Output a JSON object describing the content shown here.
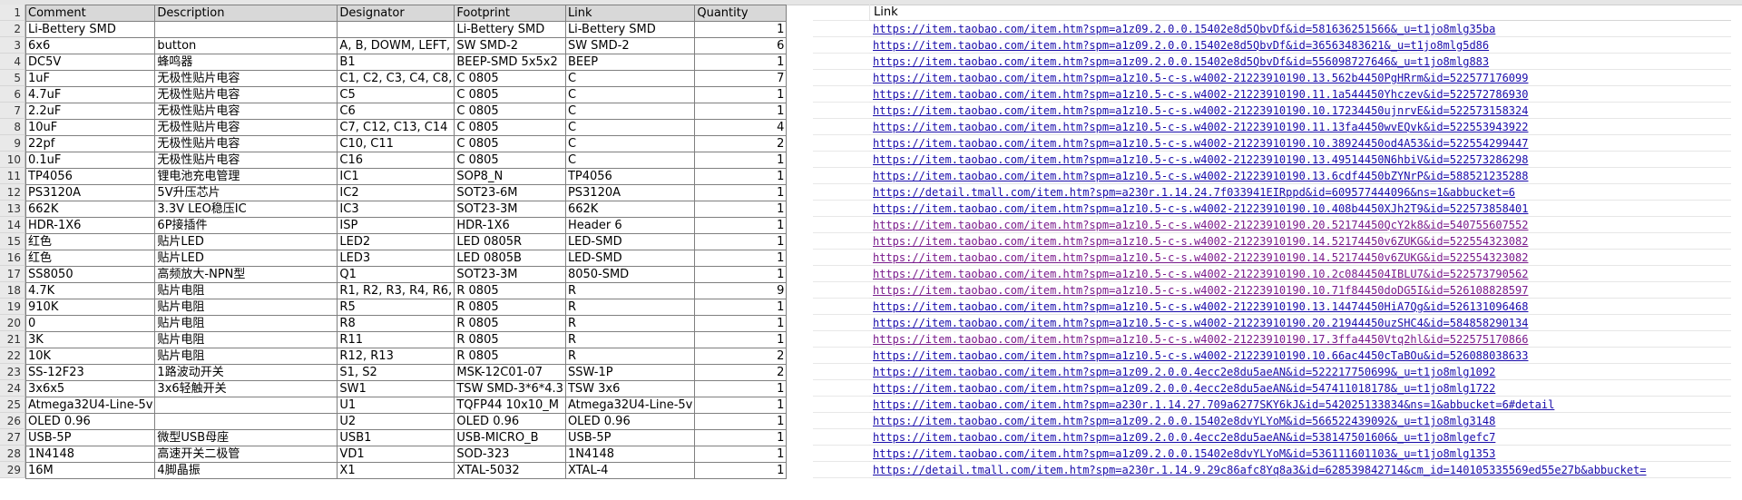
{
  "sheet": {
    "row_numbers": [
      "1",
      "2",
      "3",
      "4",
      "5",
      "6",
      "7",
      "8",
      "9",
      "10",
      "11",
      "12",
      "13",
      "14",
      "15",
      "16",
      "17",
      "18",
      "19",
      "20",
      "21",
      "22",
      "23",
      "24",
      "25",
      "26",
      "27",
      "28",
      "29"
    ],
    "headers": [
      "Comment",
      "Description",
      "Designator",
      "Footprint",
      "Link",
      "Quantity"
    ],
    "link_header": "Link",
    "rows": [
      [
        "Li-Bettery SMD",
        "",
        "",
        "Li-Bettery SMD",
        "Li-Bettery SMD",
        "1"
      ],
      [
        "6x6",
        "button",
        "A, B, DOWM, LEFT,",
        "SW SMD-2",
        "SW SMD-2",
        "6"
      ],
      [
        "DC5V",
        "蜂鸣器",
        "B1",
        "BEEP-SMD 5x5x2",
        "BEEP",
        "1"
      ],
      [
        "1uF",
        "无极性贴片电容",
        "C1, C2, C3, C4, C8,",
        "C 0805",
        "C",
        "7"
      ],
      [
        "4.7uF",
        "无极性贴片电容",
        "C5",
        "C 0805",
        "C",
        "1"
      ],
      [
        "2.2uF",
        "无极性贴片电容",
        "C6",
        "C 0805",
        "C",
        "1"
      ],
      [
        "10uF",
        "无极性贴片电容",
        "C7, C12, C13, C14",
        "C 0805",
        "C",
        "4"
      ],
      [
        "22pf",
        "无极性贴片电容",
        "C10, C11",
        "C 0805",
        "C",
        "2"
      ],
      [
        "0.1uF",
        "无极性贴片电容",
        "C16",
        "C 0805",
        "C",
        "1"
      ],
      [
        "TP4056",
        "锂电池充电管理",
        "IC1",
        "SOP8_N",
        "TP4056",
        "1"
      ],
      [
        "PS3120A",
        "5V升压芯片",
        "IC2",
        "SOT23-6M",
        "PS3120A",
        "1"
      ],
      [
        "662K",
        "3.3V LEO稳压IC",
        "IC3",
        "SOT23-3M",
        "662K",
        "1"
      ],
      [
        "HDR-1X6",
        "6P接插件",
        "ISP",
        "HDR-1X6",
        "Header 6",
        "1"
      ],
      [
        "红色",
        "贴片LED",
        "LED2",
        "LED 0805R",
        "LED-SMD",
        "1"
      ],
      [
        "红色",
        "贴片LED",
        "LED3",
        "LED 0805B",
        "LED-SMD",
        "1"
      ],
      [
        "SS8050",
        "高频放大-NPN型",
        "Q1",
        "SOT23-3M",
        "8050-SMD",
        "1"
      ],
      [
        "4.7K",
        "贴片电阻",
        "R1, R2, R3, R4, R6,",
        "R 0805",
        "R",
        "9"
      ],
      [
        "910K",
        "贴片电阻",
        "R5",
        "R 0805",
        "R",
        "1"
      ],
      [
        "0",
        "贴片电阻",
        "R8",
        "R 0805",
        "R",
        "1"
      ],
      [
        "3K",
        "贴片电阻",
        "R11",
        "R 0805",
        "R",
        "1"
      ],
      [
        "10K",
        "贴片电阻",
        "R12, R13",
        "R 0805",
        "R",
        "2"
      ],
      [
        "SS-12F23",
        "1路波动开关",
        "S1, S2",
        "MSK-12C01-07",
        "SSW-1P",
        "2"
      ],
      [
        "3x6x5",
        "3x6轻触开关",
        "SW1",
        "TSW SMD-3*6*4.3",
        "TSW 3x6",
        "1"
      ],
      [
        "Atmega32U4-Line-5v",
        "",
        "U1",
        "TQFP44 10x10_M",
        "Atmega32U4-Line-5v",
        "1"
      ],
      [
        "OLED 0.96",
        "",
        "U2",
        "OLED 0.96",
        "OLED 0.96",
        "1"
      ],
      [
        "USB-5P",
        "微型USB母座",
        "USB1",
        "USB-MICRO_B",
        "USB-5P",
        "1"
      ],
      [
        "1N4148",
        "高速开关二极管",
        "VD1",
        "SOD-323",
        "1N4148",
        "1"
      ],
      [
        "16M",
        "4脚晶振",
        "X1",
        "XTAL-5032",
        "XTAL-4",
        "1"
      ]
    ],
    "links": [
      {
        "url": "https://item.taobao.com/item.htm?spm=a1z09.2.0.0.15402e8d5QbvDf&id=581636251566&_u=t1jo8mlg35ba",
        "visited": false
      },
      {
        "url": "https://item.taobao.com/item.htm?spm=a1z09.2.0.0.15402e8d5QbvDf&id=36563483621&_u=t1jo8mlg5d86",
        "visited": false
      },
      {
        "url": "https://item.taobao.com/item.htm?spm=a1z09.2.0.0.15402e8d5QbvDf&id=556098727646&_u=t1jo8mlg883",
        "visited": false
      },
      {
        "url": "https://item.taobao.com/item.htm?spm=a1z10.5-c-s.w4002-21223910190.13.562b4450PgHRrm&id=522577176099",
        "visited": false
      },
      {
        "url": "https://item.taobao.com/item.htm?spm=a1z10.5-c-s.w4002-21223910190.11.1a544450Yhczev&id=522572786930",
        "visited": false
      },
      {
        "url": "https://item.taobao.com/item.htm?spm=a1z10.5-c-s.w4002-21223910190.10.17234450ujnrvE&id=522573158324",
        "visited": false
      },
      {
        "url": "https://item.taobao.com/item.htm?spm=a1z10.5-c-s.w4002-21223910190.11.13fa4450wvEQvk&id=522553943922",
        "visited": false
      },
      {
        "url": "https://item.taobao.com/item.htm?spm=a1z10.5-c-s.w4002-21223910190.10.38924450od4A53&id=522554299447",
        "visited": false
      },
      {
        "url": "https://item.taobao.com/item.htm?spm=a1z10.5-c-s.w4002-21223910190.13.49514450N6hbiV&id=522573286298",
        "visited": false
      },
      {
        "url": "https://item.taobao.com/item.htm?spm=a1z10.5-c-s.w4002-21223910190.13.6cdf4450bZYNrP&id=588521235288",
        "visited": false
      },
      {
        "url": "https://detail.tmall.com/item.htm?spm=a230r.1.14.24.7f033941EIRppd&id=609577444096&ns=1&abbucket=6",
        "visited": false
      },
      {
        "url": "https://item.taobao.com/item.htm?spm=a1z10.5-c-s.w4002-21223910190.10.408b4450XJh2T9&id=522573858401",
        "visited": false
      },
      {
        "url": "https://item.taobao.com/item.htm?spm=a1z10.5-c-s.w4002-21223910190.20.52174450QcY2k8&id=540755607552",
        "visited": true
      },
      {
        "url": "https://item.taobao.com/item.htm?spm=a1z10.5-c-s.w4002-21223910190.14.52174450v6ZUKG&id=522554323082",
        "visited": true
      },
      {
        "url": "https://item.taobao.com/item.htm?spm=a1z10.5-c-s.w4002-21223910190.14.52174450v6ZUKG&id=522554323082",
        "visited": true
      },
      {
        "url": "https://item.taobao.com/item.htm?spm=a1z10.5-c-s.w4002-21223910190.10.2c0844504IBLU7&id=522573790562",
        "visited": true
      },
      {
        "url": "https://item.taobao.com/item.htm?spm=a1z10.5-c-s.w4002-21223910190.10.71f84450doDG5I&id=526108828597",
        "visited": true
      },
      {
        "url": "https://item.taobao.com/item.htm?spm=a1z10.5-c-s.w4002-21223910190.13.14474450HiA7Qg&id=526131096468",
        "visited": false
      },
      {
        "url": "https://item.taobao.com/item.htm?spm=a1z10.5-c-s.w4002-21223910190.20.21944450uzSHC4&id=584858290134",
        "visited": false
      },
      {
        "url": "https://item.taobao.com/item.htm?spm=a1z10.5-c-s.w4002-21223910190.17.3ffa4450Vtq2hl&id=522575170866",
        "visited": true
      },
      {
        "url": "https://item.taobao.com/item.htm?spm=a1z10.5-c-s.w4002-21223910190.10.66ac4450cTaBOu&id=526088038633",
        "visited": false
      },
      {
        "url": "https://item.taobao.com/item.htm?spm=a1z09.2.0.0.4ecc2e8du5aeAN&id=522217750699&_u=t1jo8mlg1092",
        "visited": false
      },
      {
        "url": "https://item.taobao.com/item.htm?spm=a1z09.2.0.0.4ecc2e8du5aeAN&id=547411018178&_u=t1jo8mlg1722",
        "visited": false
      },
      {
        "url": "https://item.taobao.com/item.htm?spm=a230r.1.14.27.709a6277SKY6kJ&id=542025133834&ns=1&abbucket=6#detail",
        "visited": false
      },
      {
        "url": "https://item.taobao.com/item.htm?spm=a1z09.2.0.0.15402e8dvYLYoM&id=566522439092&_u=t1jo8mlg3148",
        "visited": false
      },
      {
        "url": "https://item.taobao.com/item.htm?spm=a1z09.2.0.0.4ecc2e8du5aeAN&id=538147501606&_u=t1jo8mlgefc7",
        "visited": false
      },
      {
        "url": "https://item.taobao.com/item.htm?spm=a1z09.2.0.0.15402e8dvYLYoM&id=536111601103&_u=t1jo8mlg1353",
        "visited": false
      },
      {
        "url": "https://detail.tmall.com/item.htm?spm=a230r.1.14.9.29c86afc8Yq8a3&id=628539842714&cm_id=140105335569ed55e27b&abbucket=",
        "visited": false
      }
    ]
  }
}
